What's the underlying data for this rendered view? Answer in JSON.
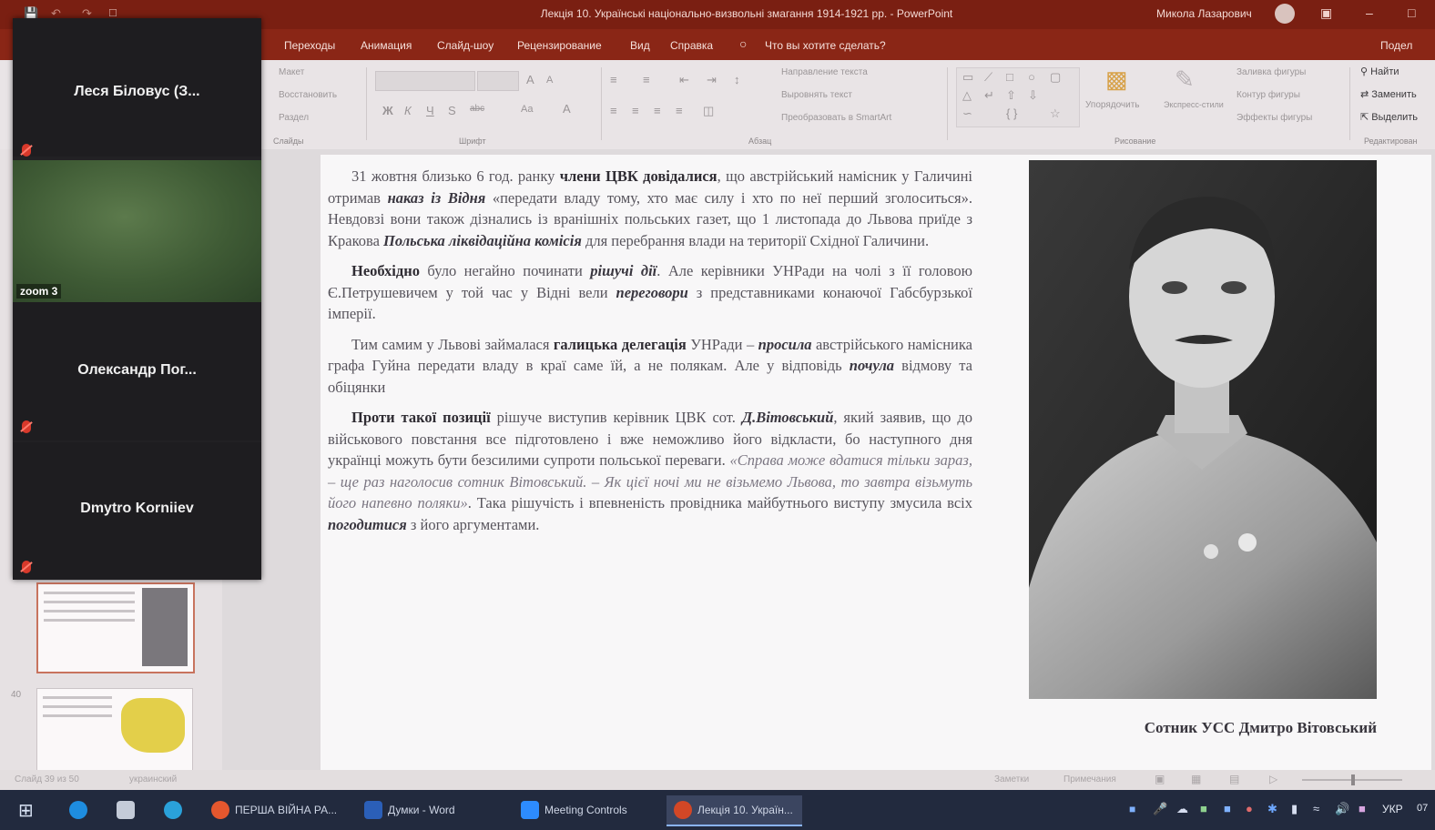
{
  "window": {
    "title": "Лекція 10. Українські національно-визвольні змагання 1914-1921 рр. - PowerPoint",
    "user": "Микола Лазарович"
  },
  "menu": {
    "tabs": [
      "Переходы",
      "Анимация",
      "Слайд-шоу",
      "Рецензирование",
      "Вид",
      "Справка"
    ],
    "tell_me": "Что вы хотите сделать?",
    "share": "Подел"
  },
  "ribbon": {
    "slides": {
      "layout": "Макет",
      "reset": "Восстановить",
      "section": "Раздел",
      "group": "Слайды"
    },
    "font_group": "Шрифт",
    "paragraph": {
      "direction": "Направление текста",
      "align": "Выровнять текст",
      "smartart": "Преобразовать в SmartArt",
      "group": "Абзац"
    },
    "drawing": {
      "arrange": "Упорядочить",
      "quick_styles": "Экспресс-стили",
      "fill": "Заливка фигуры",
      "outline": "Контур фигуры",
      "effects": "Эффекты фигуры",
      "group": "Рисование"
    },
    "editing": {
      "find": "Найти",
      "replace": "Заменить",
      "select": "Выделить",
      "group": "Редактирован"
    }
  },
  "thumbnails": {
    "next_number": "40"
  },
  "slide": {
    "p1": {
      "a": "31 жовтня близько 6 год. ранку ",
      "b": "члени ЦВК довідалися",
      "c": ", що австрійський намісник у Галичині отримав ",
      "d": "наказ із Відня",
      "e": " «передати владу тому, хто має силу і хто по неї перший зголоситься». Невдовзі вони також дізнались із вранішніх польських газет, що 1 листопада до Львова приїде з Кракова ",
      "f": "Польська ліквідаційна комісія",
      "g": " для перебрання влади на території Східної Галичини."
    },
    "p2": {
      "a": "Необхідно",
      "b": " було негайно починати ",
      "c": "рішучі дії",
      "d": ". Але керівники УНРади на чолі з її головою Є.Петрушевичем у той час у Відні вели ",
      "e": "переговори",
      "f": " з представниками конаючої Габсбурзької імперії."
    },
    "p3": {
      "a": "Тим самим у Львові займалася ",
      "b": "галицька делегація",
      "c": " УНРади – ",
      "d": "просила",
      "e": " австрійського намісника графа Гуйна передати владу в краї саме їй, а не полякам. Але у відповідь ",
      "f": "почула",
      "g": " відмову та обіцянки"
    },
    "p4": {
      "a": "Проти такої позиції",
      "b": " рішуче виступив керівник ЦВК сот. ",
      "c": "Д.Вітовський",
      "d": ", який заявив, що до військового повстання все підготовлено і вже неможливо його відкласти, бо наступного дня українці можуть бути безсилими супроти польської переваги. ",
      "e": "«Справа може вдатися тільки зараз, – ще раз наголосив сотник Вітовський. – Як цієї ночі ми не візьмемо Львова, то завтра візьмуть його напевно поляки»",
      "f": ". Така рішучість і впевненість провідника майбутнього виступу змусила всіх ",
      "g": "погодитися",
      "h": " з його аргументами."
    },
    "caption": "Сотник УСС Дмитро Вітовський"
  },
  "statusbar": {
    "left": "Слайд 39 из 50",
    "lang": "украинский",
    "notes": "Заметки",
    "comments": "Примечания"
  },
  "zoom": {
    "participants": [
      {
        "name": "Леся Біловус (З..."
      },
      {
        "name": "Олександр Пог..."
      },
      {
        "name": "Dmytro Korniiev"
      }
    ],
    "video_label": "zoom 3"
  },
  "taskbar": {
    "apps": [
      {
        "label": "ПЕРША ВІЙНА РА...",
        "color": "#e4572e"
      },
      {
        "label": "Думки - Word",
        "color": "#2b5fb8"
      },
      {
        "label": "Meeting Controls",
        "color": "#2d8cff"
      },
      {
        "label": "Лекція 10. Україн...",
        "color": "#d24726"
      }
    ],
    "lang": "УКР",
    "clock": "07"
  },
  "colors": {
    "accent": "#8a2616",
    "taskbar": "#222a3e"
  }
}
